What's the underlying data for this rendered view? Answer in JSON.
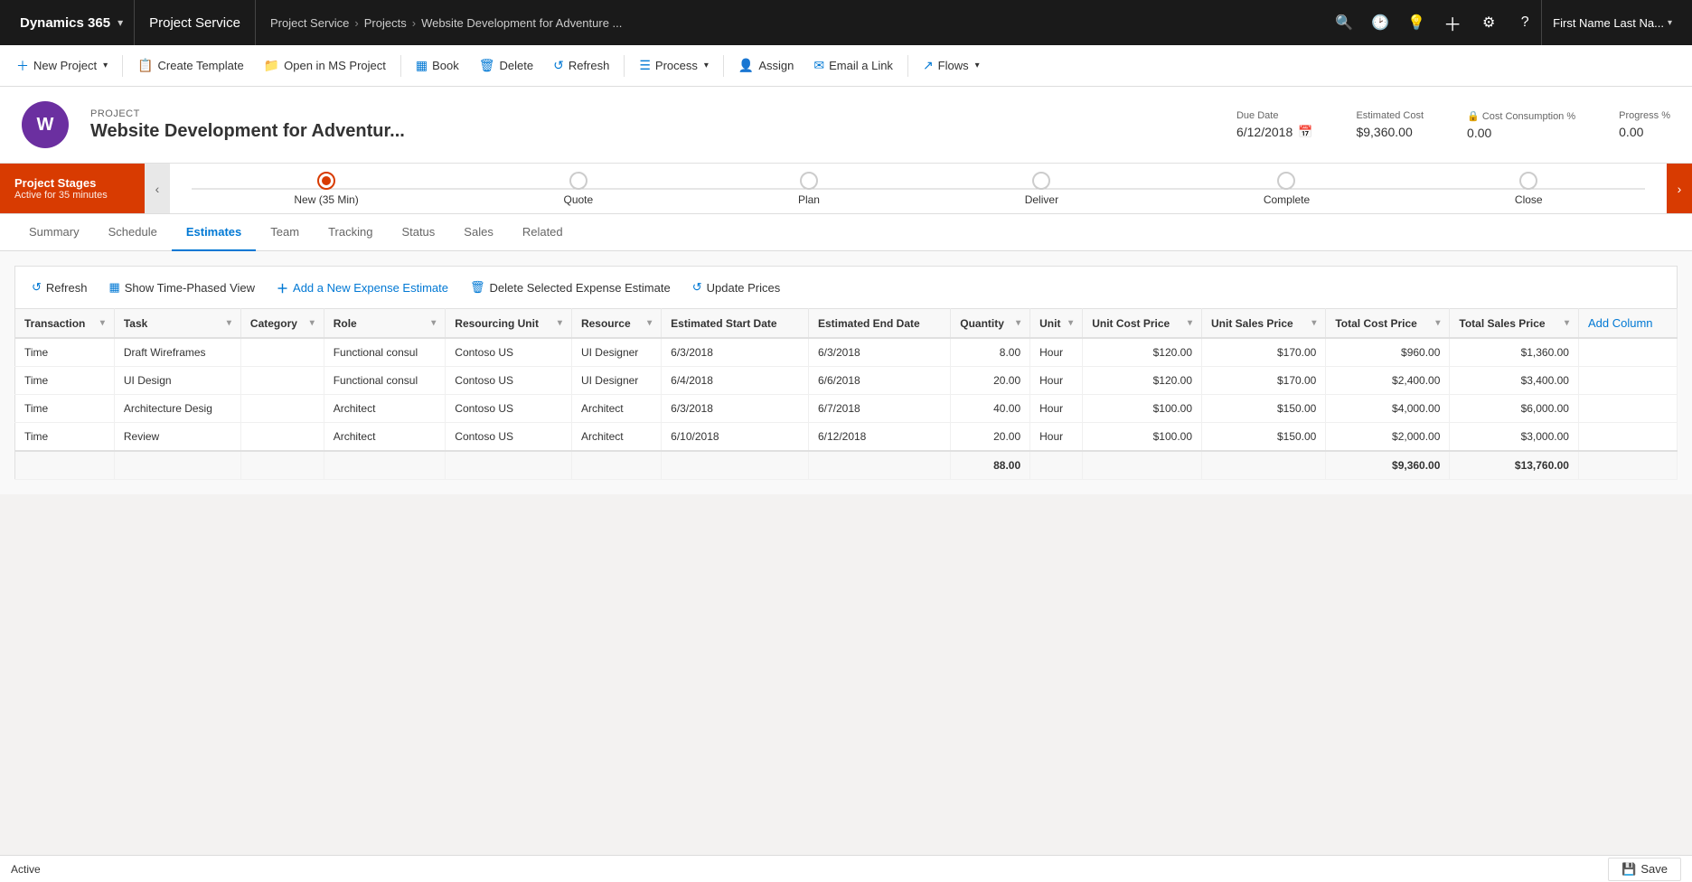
{
  "topNav": {
    "brand": "Dynamics 365",
    "brandChevron": "▾",
    "app": "Project Service",
    "breadcrumbs": [
      "Project Service",
      "Projects",
      "Website Development for Adventure ..."
    ],
    "icons": [
      "🔍",
      "🕑",
      "💡",
      "＋",
      "⚙",
      "?"
    ],
    "user": "First Name Last Na..."
  },
  "actionBar": {
    "buttons": [
      {
        "label": "New Project",
        "icon": "＋",
        "hasDropdown": true
      },
      {
        "label": "Create Template",
        "icon": "📋",
        "hasDropdown": false
      },
      {
        "label": "Open in MS Project",
        "icon": "📁",
        "hasDropdown": false
      },
      {
        "label": "Book",
        "icon": "▦",
        "hasDropdown": false
      },
      {
        "label": "Delete",
        "icon": "🗑",
        "hasDropdown": false
      },
      {
        "label": "Refresh",
        "icon": "↺",
        "hasDropdown": false
      },
      {
        "label": "Process",
        "icon": "☰",
        "hasDropdown": true
      },
      {
        "label": "Assign",
        "icon": "👤",
        "hasDropdown": false
      },
      {
        "label": "Email a Link",
        "icon": "✉",
        "hasDropdown": false
      },
      {
        "label": "Flows",
        "icon": "↗",
        "hasDropdown": true
      }
    ]
  },
  "projectHeader": {
    "label": "PROJECT",
    "title": "Website Development for Adventur...",
    "avatarInitial": "W",
    "dueDate": {
      "label": "Due Date",
      "value": "6/12/2018"
    },
    "estimatedCost": {
      "label": "Estimated Cost",
      "value": "$9,360.00"
    },
    "costConsumption": {
      "label": "Cost Consumption %",
      "value": "0.00"
    },
    "progress": {
      "label": "Progress %",
      "value": "0.00"
    }
  },
  "stageBar": {
    "label": "Project Stages",
    "subLabel": "Active for 35 minutes",
    "stages": [
      {
        "name": "New  (35 Min)",
        "active": true
      },
      {
        "name": "Quote",
        "active": false
      },
      {
        "name": "Plan",
        "active": false
      },
      {
        "name": "Deliver",
        "active": false
      },
      {
        "name": "Complete",
        "active": false
      },
      {
        "name": "Close",
        "active": false
      }
    ]
  },
  "tabs": [
    {
      "label": "Summary",
      "active": false
    },
    {
      "label": "Schedule",
      "active": false
    },
    {
      "label": "Estimates",
      "active": true
    },
    {
      "label": "Team",
      "active": false
    },
    {
      "label": "Tracking",
      "active": false
    },
    {
      "label": "Status",
      "active": false
    },
    {
      "label": "Sales",
      "active": false
    },
    {
      "label": "Related",
      "active": false
    }
  ],
  "subToolbar": {
    "buttons": [
      {
        "label": "Refresh",
        "icon": "↺"
      },
      {
        "label": "Show Time-Phased View",
        "icon": "▦"
      },
      {
        "label": "Add a New Expense Estimate",
        "icon": "＋"
      },
      {
        "label": "Delete Selected Expense Estimate",
        "icon": "🗑"
      },
      {
        "label": "Update Prices",
        "icon": "↺"
      }
    ]
  },
  "table": {
    "columns": [
      {
        "label": "Transaction",
        "sortable": true
      },
      {
        "label": "Task",
        "sortable": true
      },
      {
        "label": "Category",
        "sortable": true
      },
      {
        "label": "Role",
        "sortable": true
      },
      {
        "label": "Resourcing Unit",
        "sortable": true
      },
      {
        "label": "Resource",
        "sortable": true
      },
      {
        "label": "Estimated Start Date",
        "sortable": false
      },
      {
        "label": "Estimated End Date",
        "sortable": false
      },
      {
        "label": "Quantity",
        "sortable": true
      },
      {
        "label": "Unit",
        "sortable": true
      },
      {
        "label": "Unit Cost Price",
        "sortable": true
      },
      {
        "label": "Unit Sales Price",
        "sortable": true
      },
      {
        "label": "Total Cost Price",
        "sortable": true
      },
      {
        "label": "Total Sales Price",
        "sortable": true
      },
      {
        "label": "Add Column",
        "sortable": false,
        "isAction": true
      }
    ],
    "rows": [
      {
        "transaction": "Time",
        "task": "Draft Wireframes",
        "category": "",
        "role": "Functional consul",
        "resourcingUnit": "Contoso US",
        "resource": "UI Designer",
        "startDate": "6/3/2018",
        "endDate": "6/3/2018",
        "quantity": "8.00",
        "unit": "Hour",
        "unitCostPrice": "$120.00",
        "unitSalesPrice": "$170.00",
        "totalCostPrice": "$960.00",
        "totalSalesPrice": "$1,360.00"
      },
      {
        "transaction": "Time",
        "task": "UI Design",
        "category": "",
        "role": "Functional consul",
        "resourcingUnit": "Contoso US",
        "resource": "UI Designer",
        "startDate": "6/4/2018",
        "endDate": "6/6/2018",
        "quantity": "20.00",
        "unit": "Hour",
        "unitCostPrice": "$120.00",
        "unitSalesPrice": "$170.00",
        "totalCostPrice": "$2,400.00",
        "totalSalesPrice": "$3,400.00"
      },
      {
        "transaction": "Time",
        "task": "Architecture Desig",
        "category": "",
        "role": "Architect",
        "resourcingUnit": "Contoso US",
        "resource": "Architect",
        "startDate": "6/3/2018",
        "endDate": "6/7/2018",
        "quantity": "40.00",
        "unit": "Hour",
        "unitCostPrice": "$100.00",
        "unitSalesPrice": "$150.00",
        "totalCostPrice": "$4,000.00",
        "totalSalesPrice": "$6,000.00"
      },
      {
        "transaction": "Time",
        "task": "Review",
        "category": "",
        "role": "Architect",
        "resourcingUnit": "Contoso US",
        "resource": "Architect",
        "startDate": "6/10/2018",
        "endDate": "6/12/2018",
        "quantity": "20.00",
        "unit": "Hour",
        "unitCostPrice": "$100.00",
        "unitSalesPrice": "$150.00",
        "totalCostPrice": "$2,000.00",
        "totalSalesPrice": "$3,000.00"
      }
    ],
    "totals": {
      "quantity": "88.00",
      "totalCostPrice": "$9,360.00",
      "totalSalesPrice": "$13,760.00"
    }
  },
  "statusBar": {
    "status": "Active",
    "saveLabel": "Save",
    "saveIcon": "💾"
  }
}
